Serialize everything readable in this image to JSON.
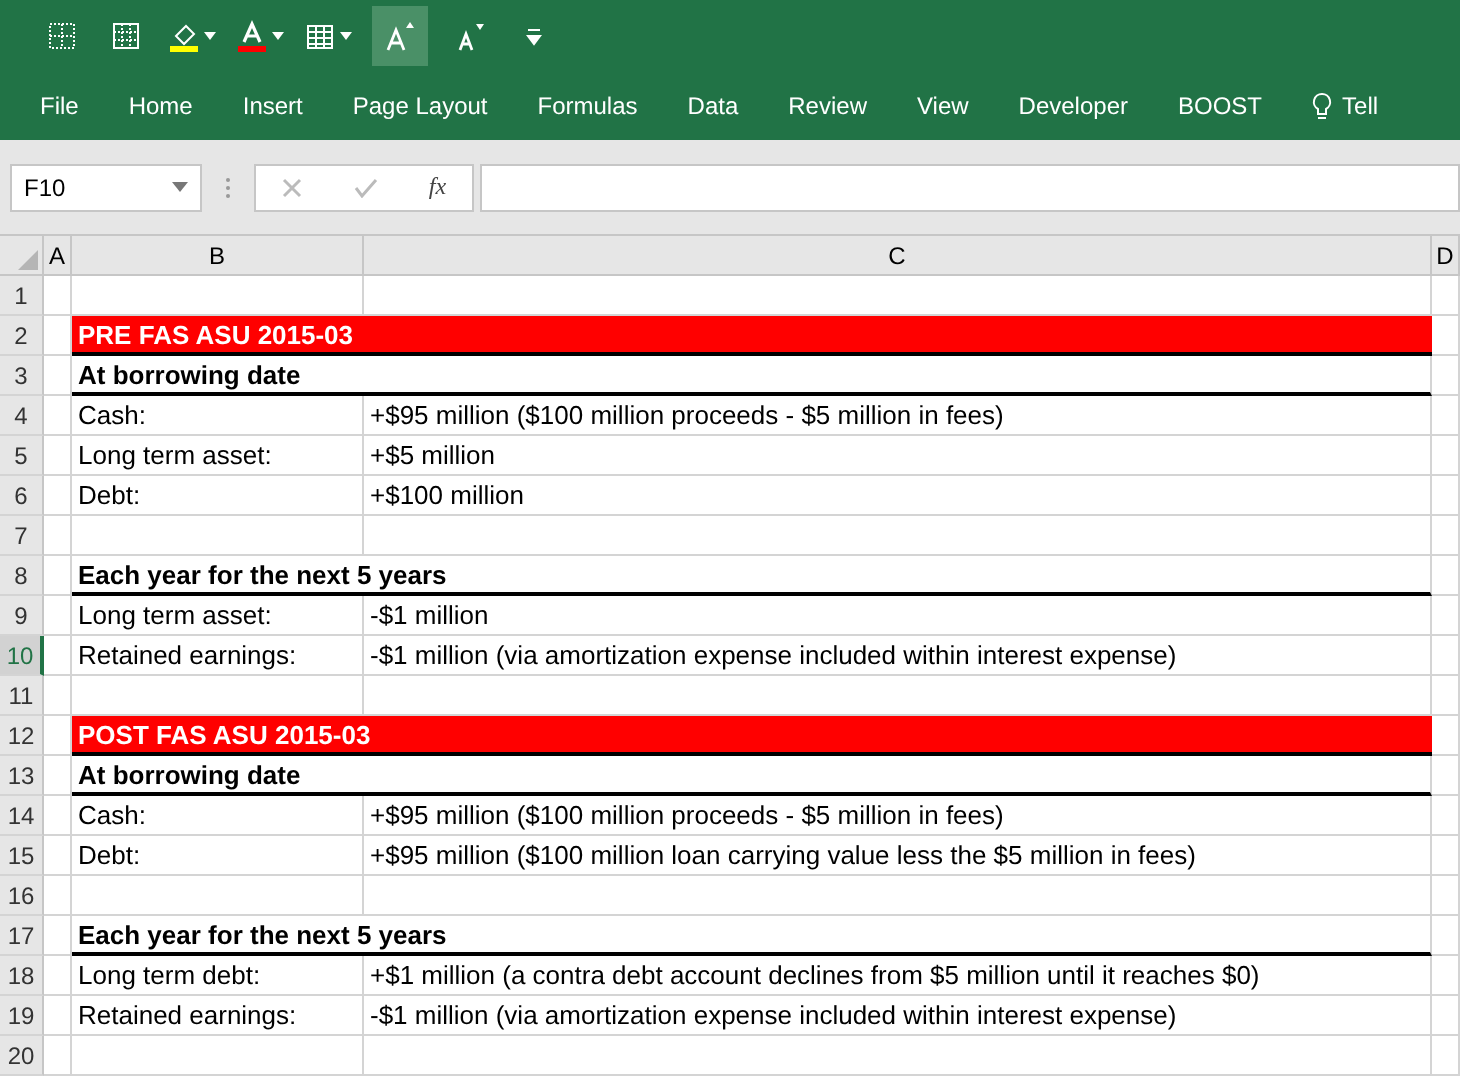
{
  "ribbon_tabs": [
    {
      "label": "File"
    },
    {
      "label": "Home"
    },
    {
      "label": "Insert"
    },
    {
      "label": "Page Layout"
    },
    {
      "label": "Formulas"
    },
    {
      "label": "Data"
    },
    {
      "label": "Review"
    },
    {
      "label": "View"
    },
    {
      "label": "Developer"
    },
    {
      "label": "BOOST"
    },
    {
      "label": "Tell",
      "kind": "search"
    }
  ],
  "formula_bar": {
    "name_box": "F10",
    "function_label": "fx"
  },
  "columns": [
    "A",
    "B",
    "C",
    "D"
  ],
  "rows": [
    {
      "number": "1",
      "kind": "blank",
      "selected": false
    },
    {
      "number": "2",
      "kind": "header",
      "selected": false,
      "label": "PRE FAS ASU 2015-03"
    },
    {
      "number": "3",
      "kind": "subhead",
      "selected": false,
      "label": "At borrowing date"
    },
    {
      "number": "4",
      "kind": "item",
      "selected": false,
      "label": "Cash:",
      "value": "+$95 million ($100 million proceeds - $5 million in fees)"
    },
    {
      "number": "5",
      "kind": "item",
      "selected": false,
      "label": "Long term asset:",
      "value": "+$5 million"
    },
    {
      "number": "6",
      "kind": "item",
      "selected": false,
      "label": "Debt:",
      "value": "+$100 million"
    },
    {
      "number": "7",
      "kind": "blank",
      "selected": false
    },
    {
      "number": "8",
      "kind": "subhead",
      "selected": false,
      "label": "Each year for the next 5 years"
    },
    {
      "number": "9",
      "kind": "item",
      "selected": false,
      "label": "Long term asset:",
      "value": "-$1 million"
    },
    {
      "number": "10",
      "kind": "item",
      "selected": true,
      "label": "Retained earnings:",
      "value": "-$1 million (via amortization expense included within interest expense)"
    },
    {
      "number": "11",
      "kind": "blank",
      "selected": false
    },
    {
      "number": "12",
      "kind": "header",
      "selected": false,
      "label": "POST FAS ASU 2015-03"
    },
    {
      "number": "13",
      "kind": "subhead",
      "selected": false,
      "label": "At borrowing date"
    },
    {
      "number": "14",
      "kind": "item",
      "selected": false,
      "label": "Cash:",
      "value": "+$95 million ($100 million proceeds - $5 million in fees)"
    },
    {
      "number": "15",
      "kind": "item",
      "selected": false,
      "label": "Debt:",
      "value": "+$95 million ($100 million loan carrying value less the $5 million in fees)"
    },
    {
      "number": "16",
      "kind": "blank",
      "selected": false
    },
    {
      "number": "17",
      "kind": "subhead",
      "selected": false,
      "label": "Each year for the next 5 years"
    },
    {
      "number": "18",
      "kind": "item",
      "selected": false,
      "label": "Long term debt:",
      "value": "+$1 million (a contra debt account declines from $5 million until it reaches $0)"
    },
    {
      "number": "19",
      "kind": "item",
      "selected": false,
      "label": "Retained earnings:",
      "value": "-$1 million (via amortization expense included within interest expense)"
    },
    {
      "number": "20",
      "kind": "blank",
      "selected": false
    }
  ]
}
